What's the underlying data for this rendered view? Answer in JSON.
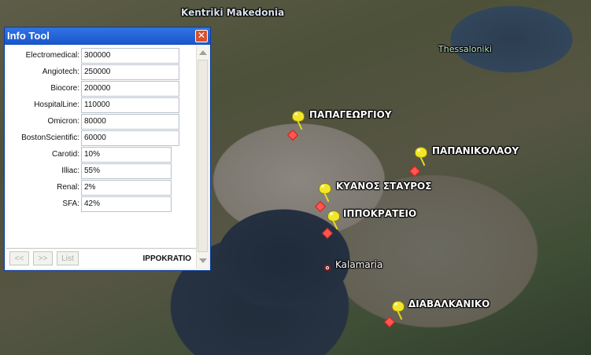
{
  "map": {
    "region_label": "Kentriki Makedonia",
    "city_label": "Thessaloniki",
    "kalamaria_label": "Kalamaria",
    "places": [
      {
        "name": "ΠΑΠΑΓΕΩΡΓΙΟΥ"
      },
      {
        "name": "ΠΑΠΑΝΙΚΟΛΑΟΥ"
      },
      {
        "name": "ΚΥΑΝΟΣ ΣΤΑΥΡΟΣ"
      },
      {
        "name": "ΙΠΠΟΚΡΑΤΕΙΟ"
      },
      {
        "name": "ΔΙΑΒΑΛΚΑΝΙΚΟ"
      }
    ]
  },
  "info_tool": {
    "title": "Info Tool",
    "close_symbol": "✕",
    "fields": [
      {
        "label": "Electromedical:",
        "value": "300000"
      },
      {
        "label": "Angiotech:",
        "value": "250000"
      },
      {
        "label": "Biocore:",
        "value": "200000"
      },
      {
        "label": "HospitalLine:",
        "value": "110000"
      },
      {
        "label": "Omicron:",
        "value": "80000"
      },
      {
        "label": "BostonScientific:",
        "value": "60000"
      },
      {
        "label": "Carotid:",
        "value": "10%"
      },
      {
        "label": "Illiac:",
        "value": "55%"
      },
      {
        "label": "Renal:",
        "value": "2%"
      },
      {
        "label": "SFA:",
        "value": "42%"
      }
    ],
    "nav": {
      "prev": "<<",
      "next": ">>",
      "list": "List"
    },
    "site_name": "IPPOKRATIO"
  },
  "colors": {
    "titlebar": "#1a55c8",
    "pin": "#f2e62b",
    "marker": "#ff5555"
  }
}
